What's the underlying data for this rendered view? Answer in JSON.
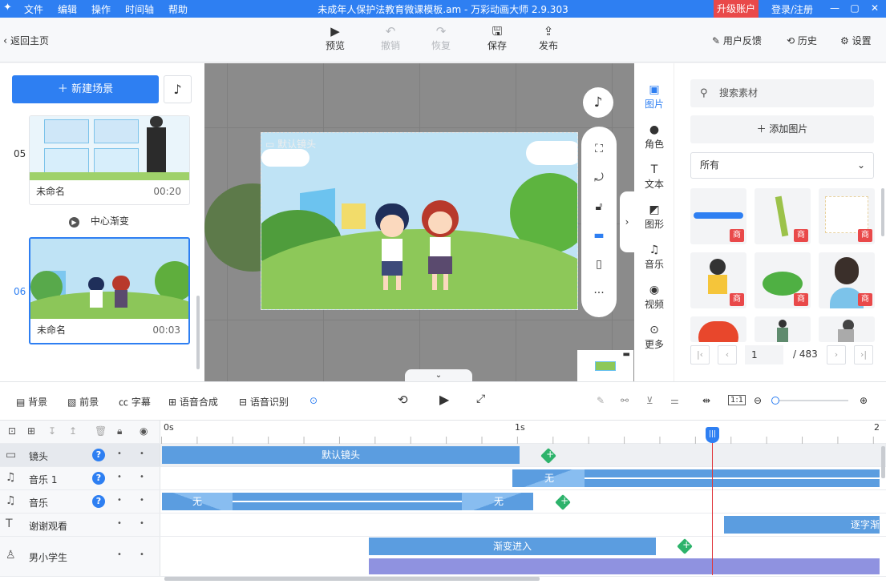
{
  "titlebar": {
    "menus": [
      "文件",
      "编辑",
      "操作",
      "时间轴",
      "帮助"
    ],
    "title": "未成年人保护法教育微课模板.am - 万彩动画大师 2.9.303",
    "upgrade": "升级账户",
    "login": "登录/注册"
  },
  "toolbar": {
    "back": "返回主页",
    "preview": "预览",
    "undo": "撤销",
    "redo": "恢复",
    "save": "保存",
    "publish": "发布",
    "feedback": "用户反馈",
    "history": "历史",
    "settings": "设置"
  },
  "scenes": {
    "new_scene": "新建场景",
    "items": [
      {
        "num": "05",
        "name": "未命名",
        "time": "00:20"
      },
      {
        "num": "06",
        "name": "未命名",
        "time": "00:03"
      }
    ],
    "transition": "中心渐变"
  },
  "canvas": {
    "camera_label": "默认镜头"
  },
  "side_tabs": [
    "图片",
    "角色",
    "文本",
    "图形",
    "音乐",
    "视频",
    "更多"
  ],
  "assets": {
    "search_placeholder": "搜索素材",
    "add_picture": "添加图片",
    "filter": "所有",
    "badge": "商",
    "page": "1",
    "total": "/ 483"
  },
  "timeline_toolbar": {
    "background": "背景",
    "foreground": "前景",
    "subtitle": "字幕",
    "tts": "语音合成",
    "asr": "语音识别"
  },
  "ruler": [
    "0s",
    "1s",
    "2"
  ],
  "tracks": [
    {
      "name": "镜头",
      "clip": "默认镜头"
    },
    {
      "name": "音乐 1",
      "clip": "无"
    },
    {
      "name": "音乐",
      "clip_a": "无",
      "clip_b": "无"
    },
    {
      "name": "谢谢观看",
      "clip": "逐字渐"
    },
    {
      "name": "男小学生",
      "clip": "渐变进入"
    }
  ],
  "colors": {
    "accent": "#2e7ff2",
    "clip": "#5b9de0",
    "danger": "#e9494a",
    "key": "#2db36b"
  }
}
